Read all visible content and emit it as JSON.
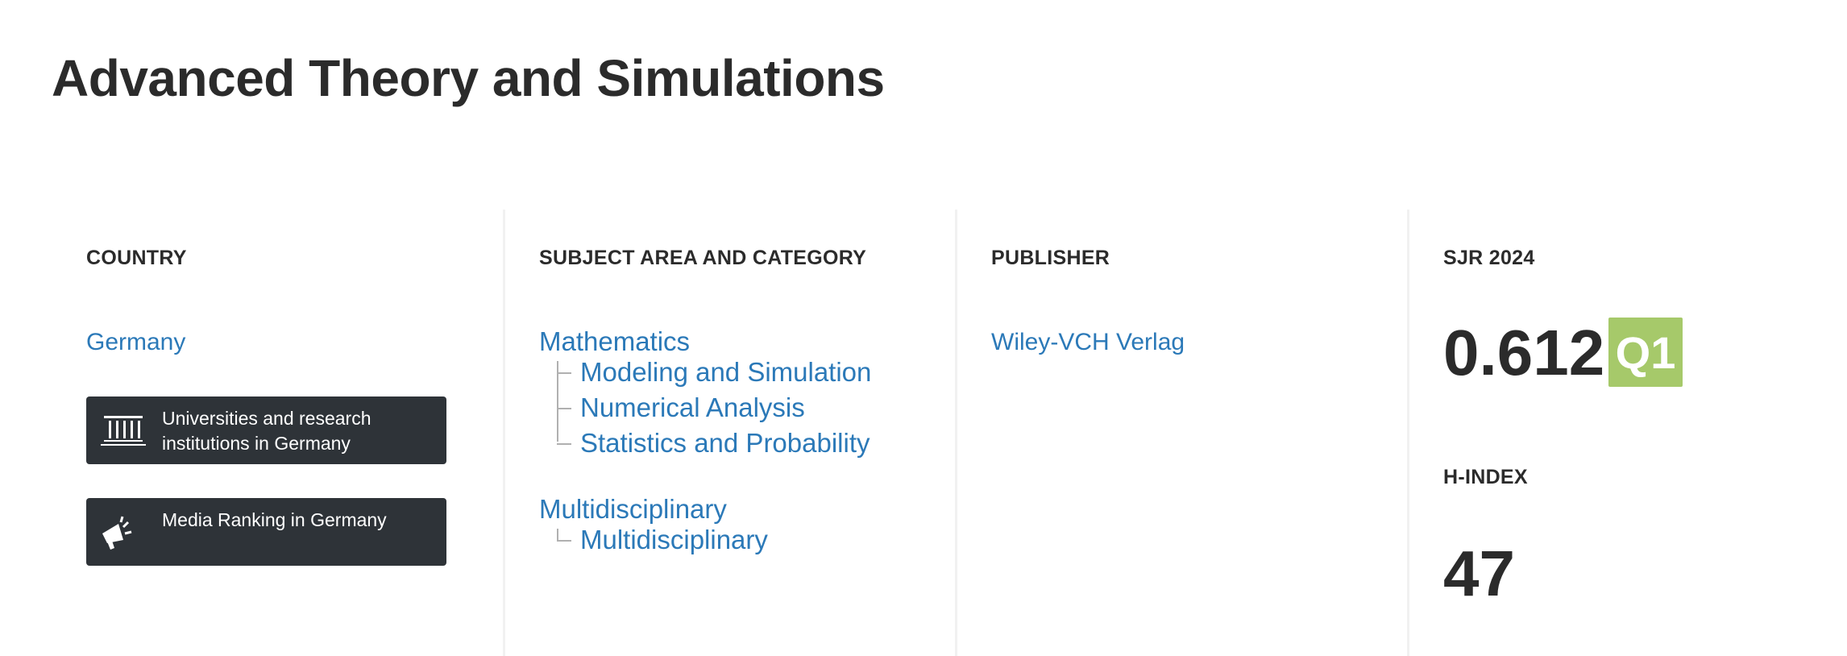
{
  "page": {
    "title": "Advanced Theory and Simulations"
  },
  "country": {
    "heading": "COUNTRY",
    "name": "Germany",
    "universities_label": "Universities and research institutions in Germany",
    "media_label": "Media Ranking in Germany",
    "universities_icon": "institution-icon",
    "media_icon": "megaphone-icon"
  },
  "subject": {
    "heading": "SUBJECT AREA AND CATEGORY",
    "areas": [
      {
        "name": "Mathematics",
        "categories": [
          "Modeling and Simulation",
          "Numerical Analysis",
          "Statistics and Probability"
        ]
      },
      {
        "name": "Multidisciplinary",
        "categories": [
          "Multidisciplinary"
        ]
      }
    ]
  },
  "publisher": {
    "heading": "PUBLISHER",
    "name": "Wiley-VCH Verlag"
  },
  "sjr": {
    "heading": "SJR 2024",
    "value": "0.612",
    "quartile": "Q1",
    "quartile_color": "#a6c96a"
  },
  "hindex": {
    "heading": "H-INDEX",
    "value": "47"
  },
  "colors": {
    "link": "#2b79b8",
    "dark_box": "#2e3338",
    "text": "#2b2b2b"
  }
}
